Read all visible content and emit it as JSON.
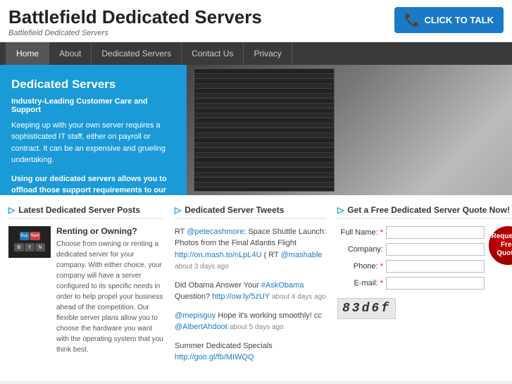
{
  "header": {
    "title": "Battlefield Dedicated Servers",
    "subtitle": "Battlefield Dedicated Servers",
    "cta": "CLICK TO TALK"
  },
  "nav": {
    "items": [
      "Home",
      "About",
      "Dedicated Servers",
      "Contact Us",
      "Privacy"
    ]
  },
  "hero": {
    "title": "Dedicated Servers",
    "subtitle": "Industry-Leading Customer Care and Support",
    "body": "Keeping up with your own server requires a sophisticated IT staff, either on payroll or contract. It can be an expensive and grueling undertaking.",
    "bold_text": "Using our dedicated servers allows you to offload those support requirements to our expert support staff."
  },
  "posts": {
    "section_title": "Latest Dedicated Server Posts",
    "items": [
      {
        "title": "Renting or Owning?",
        "body": "Choose from owning or renting a dedicated server for your company. With either choice, your company will have a server configured to its specific needs in order to help propel your business ahead of the competition. Our flexible server plans allow you to choose the hardware you want with the operating system that you think best."
      }
    ]
  },
  "tweets": {
    "section_title": "Dedicated Server Tweets",
    "items": [
      {
        "text": "RT @petecashmore: Space Shuttle Launch: Photos from the Final Atlantis Flight",
        "link": "http://on.mash.to/nLpL4U",
        "extra": "( RT @mashable",
        "time": "about 3 days ago"
      },
      {
        "text": "Did Obama Answer Your #AskObama Question?",
        "link": "http://ow.ly/5zUY",
        "time": "about 4 days ago"
      },
      {
        "text": "@mepisguy Hope it's working smoothly! cc @AlbertAhdoot",
        "time": "about 5 days ago"
      },
      {
        "text": "Summer Dedicated Specials",
        "link": "http://goo.gl/fb/MIWQQ"
      }
    ]
  },
  "quote": {
    "section_title": "Get a Free Dedicated Server Quote Now!",
    "fields": [
      {
        "label": "Full Name:",
        "name": "full-name",
        "required": true
      },
      {
        "label": "Company:",
        "name": "company",
        "required": false
      },
      {
        "label": "Phone:",
        "name": "phone",
        "required": true
      },
      {
        "label": "E-mail:",
        "name": "email",
        "required": true
      }
    ],
    "button_label": "Request a Free Quote!",
    "captcha_text": "83d6f"
  }
}
